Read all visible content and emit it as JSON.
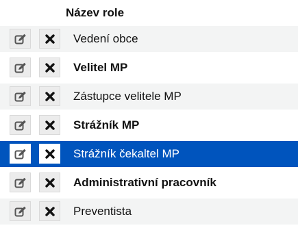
{
  "table": {
    "column_header": "Název role",
    "selected_index": 4,
    "rows": [
      {
        "name": "Vedení obce",
        "bold": false
      },
      {
        "name": "Velitel MP",
        "bold": true
      },
      {
        "name": "Zástupce velitele MP",
        "bold": false
      },
      {
        "name": "Strážník MP",
        "bold": true
      },
      {
        "name": "Strážník čekaltel MP",
        "bold": false
      },
      {
        "name": "Administrativní pracovník",
        "bold": true
      },
      {
        "name": "Preventista",
        "bold": false
      }
    ]
  },
  "icons": {
    "edit": "edit-icon",
    "delete": "delete-icon"
  },
  "colors": {
    "selected_background": "#0054bd",
    "zebra_background": "#f3f4f4",
    "edit_icon": "#555555",
    "delete_icon": "#111111"
  }
}
